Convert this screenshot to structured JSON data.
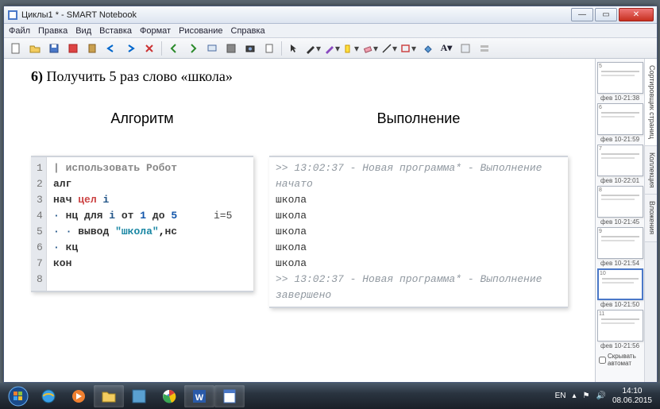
{
  "window": {
    "title": "Циклы1 * - SMART Notebook",
    "buttons": {
      "min": "—",
      "max": "▭",
      "close": "✕"
    }
  },
  "menu": [
    "Файл",
    "Правка",
    "Вид",
    "Вставка",
    "Формат",
    "Рисование",
    "Справка"
  ],
  "toolbar_icons": [
    "file",
    "open",
    "save",
    "pdf",
    "paste",
    "undo",
    "redo",
    "delete",
    "prev",
    "next",
    "screen",
    "table",
    "capture",
    "doc",
    "sep",
    "pointer",
    "pen",
    "pen2",
    "hiliter",
    "eraser",
    "line",
    "shape",
    "fill",
    "text",
    "props",
    "grid"
  ],
  "page": {
    "task_num": "6)",
    "task_text": " Получить 5 раз слово «школа»",
    "left_head": "Алгоритм",
    "right_head": "Выполнение",
    "code_lines": [
      {
        "n": "1",
        "html": "<span class='tok-c'>| использовать Робот</span>"
      },
      {
        "n": "2",
        "html": "<span class='tok-kw'>алг</span>"
      },
      {
        "n": "3",
        "html": "<span class='tok-kw'>нач</span> <span class='tok-kw2'>цел</span> <span class='tok-id'>i</span>"
      },
      {
        "n": "4",
        "html": "<span class='tok-id'>·</span> <span class='tok-kw'>нц для</span> <span class='tok-id'>i</span> <span class='tok-kw'>от</span> <span class='tok-num'>1</span> <span class='tok-kw'>до</span> <span class='tok-num'>5</span>"
      },
      {
        "n": "5",
        "html": "<span class='tok-id'>·</span> <span class='tok-id'>·</span> <span class='tok-kw'>вывод</span> <span class='tok-str'>\"школа\"</span>,<span class='tok-kw'>нс</span>"
      },
      {
        "n": "6",
        "html": "<span class='tok-id'>·</span> <span class='tok-kw'>кц</span>"
      },
      {
        "n": "7",
        "html": "<span class='tok-kw'>кон</span>"
      },
      {
        "n": "8",
        "html": ""
      }
    ],
    "annotation": "i=5",
    "output": {
      "start": ">> 13:02:37 - Новая программа* - Выполнение начато",
      "lines": [
        "школа",
        "школа",
        "школа",
        "школа",
        "школа"
      ],
      "end": ">> 13:02:37 - Новая программа* - Выполнение завершено"
    }
  },
  "thumbs": [
    {
      "label": "фев 10-21:38",
      "sel": false
    },
    {
      "label": "фев 10-21:59",
      "sel": false
    },
    {
      "label": "фев 10-22:01",
      "sel": false
    },
    {
      "label": "фев 10-21:45",
      "sel": false
    },
    {
      "label": "фев 10-21:54",
      "sel": false
    },
    {
      "label": "фев 10-21:50",
      "sel": true
    },
    {
      "label": "фев 10-21:56",
      "sel": false
    }
  ],
  "sidetabs": [
    "Сортировщик страниц",
    "Коллекция",
    "Вложения"
  ],
  "hide_auto": "Скрывать автомат",
  "tray": {
    "lang": "EN",
    "time": "14:10",
    "date": "08.06.2015"
  }
}
